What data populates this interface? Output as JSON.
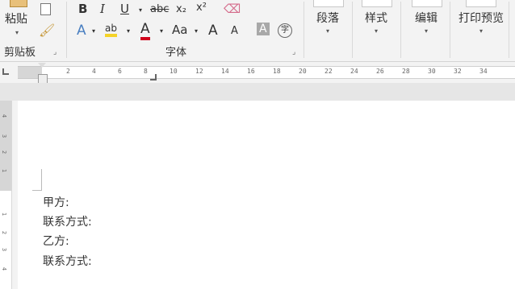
{
  "ribbon": {
    "clipboard": {
      "paste_label": "粘贴",
      "group_label": "剪贴板"
    },
    "font": {
      "bold": "B",
      "italic": "I",
      "underline": "U",
      "strikethrough": "abc",
      "subscript": "x₂",
      "superscript": "x²",
      "font_color_glyph": "A",
      "change_case": "Aa",
      "grow_font": "A",
      "shrink_font": "A",
      "char_shading": "A",
      "enclose_char": "字",
      "group_label": "字体",
      "font_color_hex": "#d0021b"
    },
    "groups": {
      "paragraph": "段落",
      "styles": "样式",
      "editing": "编辑",
      "print_preview": "打印预览"
    }
  },
  "ruler": {
    "numbers": [
      "2",
      "4",
      "6",
      "8",
      "10",
      "12",
      "14",
      "16",
      "18",
      "20",
      "22",
      "24",
      "26",
      "28",
      "30",
      "32",
      "34"
    ]
  },
  "document": {
    "lines": [
      "甲方:",
      "联系方式:",
      "乙方:",
      "联系方式:"
    ]
  }
}
